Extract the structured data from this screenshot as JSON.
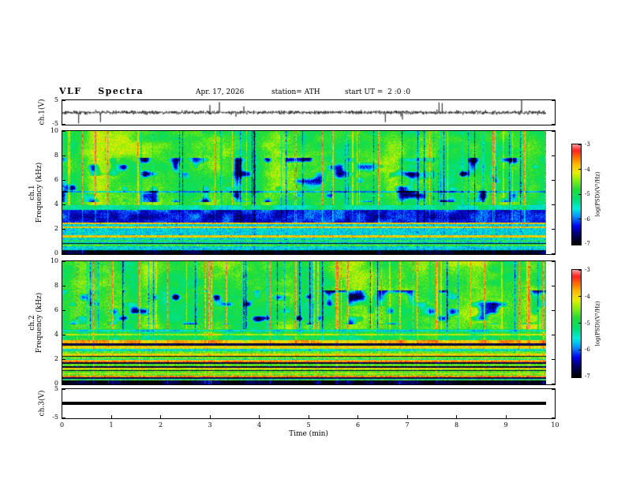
{
  "header": {
    "title": "VLF  Spectra",
    "date": "Apr. 17, 2026",
    "station": "station= ATH",
    "start_ut": "start UT =  2 :0 :0"
  },
  "xaxis": {
    "label": "Time (min)",
    "ticks": [
      "0",
      "1",
      "2",
      "3",
      "4",
      "5",
      "6",
      "7",
      "8",
      "9",
      "10"
    ],
    "range": [
      0,
      10
    ],
    "data_end_min": 9.8
  },
  "colorbar": {
    "label": "log(PSD)(V²/Hz)",
    "ticks": [
      "-3",
      "-4",
      "-5",
      "-6",
      "-7"
    ],
    "range": [
      -7,
      -3
    ]
  },
  "colormap": [
    [
      0.0,
      "#000000"
    ],
    [
      0.1,
      "#000066"
    ],
    [
      0.18,
      "#0000ee"
    ],
    [
      0.28,
      "#0099ff"
    ],
    [
      0.36,
      "#00eedd"
    ],
    [
      0.45,
      "#00dd77"
    ],
    [
      0.55,
      "#22dd33"
    ],
    [
      0.64,
      "#88ee11"
    ],
    [
      0.72,
      "#e8ee00"
    ],
    [
      0.8,
      "#ffbb00"
    ],
    [
      0.88,
      "#ff6600"
    ],
    [
      0.94,
      "#ff2222"
    ],
    [
      1.0,
      "#ff9999"
    ]
  ],
  "chart_data": [
    {
      "type": "line",
      "panel": "ch1-waveform",
      "ylabel": "ch.1(V)",
      "ylim": [
        -5,
        5
      ],
      "yticks": [
        "5",
        "-5"
      ],
      "signal": {
        "baseline_v": 0,
        "noise_amplitude_v": 0.8,
        "spike_amplitude_v": 4.5,
        "seed": 42
      },
      "description": "broadband noisy voltage trace around 0 V with frequent impulsive spikes"
    },
    {
      "type": "heatmap",
      "panel": "ch1-spectrogram",
      "ylabel": {
        "l1": "ch.1",
        "l2": "Frequency (kHz)"
      },
      "ylim": [
        0,
        10
      ],
      "yticks": [
        "0",
        "2",
        "4",
        "6",
        "8",
        "10"
      ],
      "value_range": [
        -7,
        -3
      ],
      "seed": 7,
      "bands": [
        {
          "f": [
            4.0,
            10.0
          ],
          "psd": -4.7,
          "texture": "streaks"
        },
        {
          "f": [
            3.6,
            4.0
          ],
          "psd": -5.3,
          "texture": "plain"
        },
        {
          "f": [
            2.55,
            3.6
          ],
          "psd": -6.2,
          "texture": "plain"
        },
        {
          "f": [
            0.35,
            2.55
          ],
          "psd": -5.2,
          "texture": "stripes"
        },
        {
          "f": [
            0.0,
            0.35
          ],
          "psd": -6.9,
          "texture": "plain"
        }
      ],
      "stripe_palette": [
        [
          -6.9,
          0.18
        ],
        [
          -5.6,
          0.3
        ],
        [
          -4.7,
          0.26
        ],
        [
          -5.2,
          0.12
        ],
        [
          -3.9,
          0.14
        ]
      ],
      "blob_region": [
        4.2,
        7.8
      ],
      "hlines": [
        {
          "f": 5.05,
          "psd": -5.7
        }
      ]
    },
    {
      "type": "heatmap",
      "panel": "ch2-spectrogram",
      "ylabel": {
        "l1": "ch.2",
        "l2": "Frequency (kHz)"
      },
      "ylim": [
        0,
        10
      ],
      "yticks": [
        "0",
        "2",
        "4",
        "6",
        "8",
        "10"
      ],
      "value_range": [
        -7,
        -3
      ],
      "seed": 99,
      "bands": [
        {
          "f": [
            4.5,
            10.0
          ],
          "psd": -4.7,
          "texture": "streaks"
        },
        {
          "f": [
            3.6,
            4.5
          ],
          "psd": -5.0,
          "texture": "plain"
        },
        {
          "f": [
            3.32,
            3.6
          ],
          "psd": -3.8,
          "texture": "plain"
        },
        {
          "f": [
            0.35,
            3.32
          ],
          "psd": -4.8,
          "texture": "stripes"
        },
        {
          "f": [
            0.0,
            0.35
          ],
          "psd": -6.9,
          "texture": "plain"
        }
      ],
      "stripe_palette": [
        [
          -6.8,
          0.1
        ],
        [
          -5.5,
          0.2
        ],
        [
          -4.6,
          0.3
        ],
        [
          -4.0,
          0.22
        ],
        [
          -3.6,
          0.18
        ]
      ],
      "blob_region": [
        4.9,
        7.6
      ],
      "hlines": [
        {
          "f": 4.05,
          "psd": -4.3
        },
        {
          "f": 4.35,
          "psd": -5.6
        }
      ]
    },
    {
      "type": "line",
      "panel": "ch3-waveform",
      "ylabel": "ch.3(V)",
      "ylim": [
        -5,
        5
      ],
      "yticks": [
        "5",
        "-5"
      ],
      "signal": {
        "baseline_v": 0,
        "noise_amplitude_v": 0,
        "spike_amplitude_v": 0
      },
      "description": "flat thick trace at 0 V (no signal)"
    }
  ]
}
